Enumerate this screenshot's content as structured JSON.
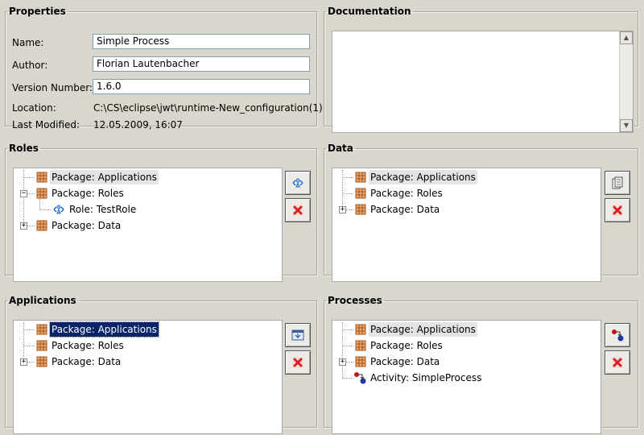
{
  "properties": {
    "title": "Properties",
    "name_label": "Name:",
    "name_value": "Simple Process",
    "author_label": "Author:",
    "author_value": "Florian Lautenbacher",
    "version_label": "Version Number:",
    "version_value": "1.6.0",
    "location_label": "Location:",
    "location_value": "C:\\CS\\eclipse\\jwt\\runtime-New_configuration(1)",
    "modified_label": "Last Modified:",
    "modified_value": "12.05.2009, 16:07"
  },
  "documentation": {
    "title": "Documentation",
    "text": ""
  },
  "roles": {
    "title": "Roles",
    "items": [
      "Package: Applications",
      "Package: Roles",
      "Role: TestRole",
      "Package: Data"
    ],
    "add_icon": "role-add-icon",
    "delete_icon": "delete-x-icon"
  },
  "data": {
    "title": "Data",
    "items": [
      "Package: Applications",
      "Package: Roles",
      "Package: Data"
    ],
    "add_icon": "data-add-icon",
    "delete_icon": "delete-x-icon"
  },
  "applications": {
    "title": "Applications",
    "items": [
      "Package: Applications",
      "Package: Roles",
      "Package: Data"
    ],
    "add_icon": "application-add-icon",
    "delete_icon": "delete-x-icon"
  },
  "processes": {
    "title": "Processes",
    "items": [
      "Package: Applications",
      "Package: Roles",
      "Package: Data",
      "Activity: SimpleProcess"
    ],
    "add_icon": "process-add-icon",
    "delete_icon": "delete-x-icon"
  },
  "colors": {
    "background": "#d8d6cd",
    "selection": "#0a246a",
    "delete_red": "#d32020",
    "package_orange": "#c96a28"
  }
}
